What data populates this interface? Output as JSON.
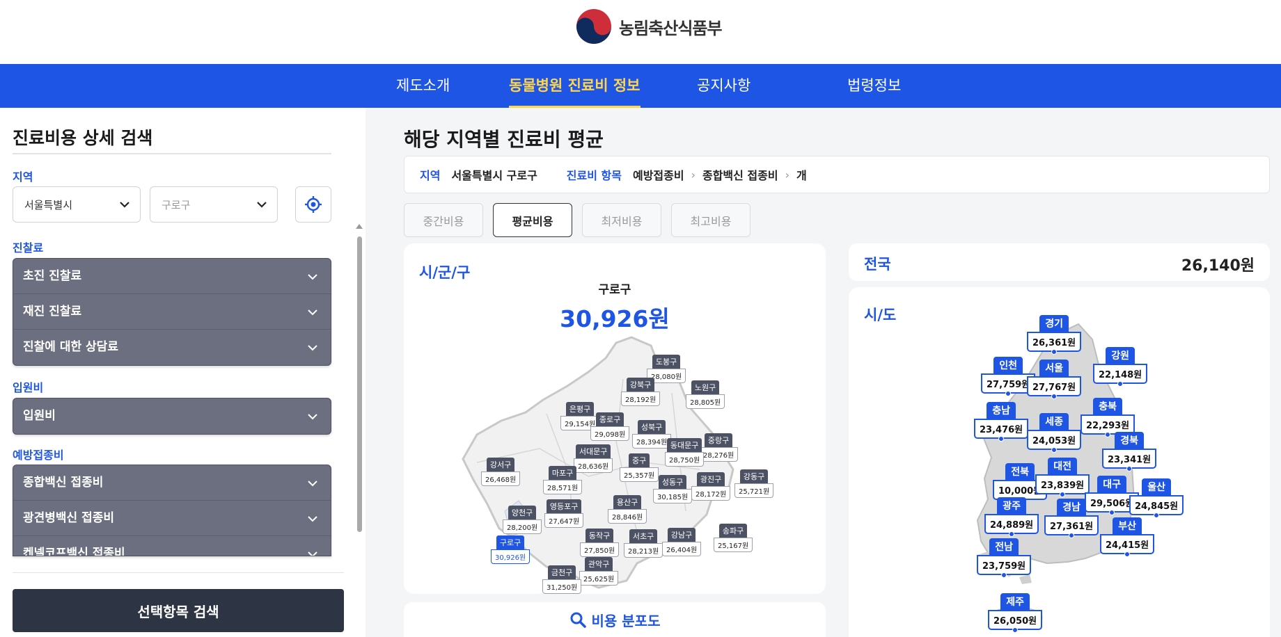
{
  "header": {
    "ministry_name": "농림축산식품부"
  },
  "nav": {
    "items": [
      {
        "label": "제도소개"
      },
      {
        "label": "동물병원 진료비 정보"
      },
      {
        "label": "공지사항"
      },
      {
        "label": "법령정보"
      }
    ],
    "active_index": 1
  },
  "sidebar": {
    "title": "진료비용 상세 검색",
    "region_label": "지역",
    "city_select": "서울특별시",
    "district_select": "구로구",
    "sections": [
      {
        "label": "진찰료",
        "items": [
          "초진 진찰료",
          "재진 진찰료",
          "진찰에 대한 상담료"
        ]
      },
      {
        "label": "입원비",
        "items": [
          "입원비"
        ]
      },
      {
        "label": "예방접종비",
        "items": [
          "종합백신 접종비",
          "광견병백신 접종비",
          "켄넬코프백신 접종비"
        ]
      }
    ],
    "search_button": "선택항목 검색"
  },
  "main": {
    "title": "해당 지역별 진료비 평균",
    "crumbs": {
      "region_key": "지역",
      "region_value": "서울특별시 구로구",
      "item_key": "진료비 항목",
      "item_path": [
        "예방접종비",
        "종합백신 접종비",
        "개"
      ]
    },
    "tabs": [
      "중간비용",
      "평균비용",
      "최저비용",
      "최고비용"
    ],
    "active_tab": 1,
    "district_card": {
      "label": "시/군/구",
      "selected_name": "구로구",
      "selected_amount": "30,926원",
      "districts": [
        {
          "name": "도봉구",
          "value": "28,080원"
        },
        {
          "name": "강북구",
          "value": "28,192원"
        },
        {
          "name": "노원구",
          "value": "28,805원"
        },
        {
          "name": "은평구",
          "value": "29,154원"
        },
        {
          "name": "종로구",
          "value": "29,098원"
        },
        {
          "name": "성북구",
          "value": "28,394원"
        },
        {
          "name": "중랑구",
          "value": "28,276원"
        },
        {
          "name": "동대문구",
          "value": "28,750원"
        },
        {
          "name": "서대문구",
          "value": "28,636원"
        },
        {
          "name": "중구",
          "value": "25,357원"
        },
        {
          "name": "강서구",
          "value": "26,468원"
        },
        {
          "name": "마포구",
          "value": "28,571원"
        },
        {
          "name": "성동구",
          "value": "30,185원"
        },
        {
          "name": "광진구",
          "value": "28,172원"
        },
        {
          "name": "강동구",
          "value": "25,721원"
        },
        {
          "name": "용산구",
          "value": "28,846원"
        },
        {
          "name": "영등포구",
          "value": "27,647원"
        },
        {
          "name": "양천구",
          "value": "28,200원"
        },
        {
          "name": "구로구",
          "value": "30,926원"
        },
        {
          "name": "동작구",
          "value": "27,850원"
        },
        {
          "name": "서초구",
          "value": "28,213원"
        },
        {
          "name": "강남구",
          "value": "26,404원"
        },
        {
          "name": "송파구",
          "value": "25,167원"
        },
        {
          "name": "관악구",
          "value": "25,625원"
        },
        {
          "name": "금천구",
          "value": "31,250원"
        }
      ]
    },
    "nation": {
      "label": "전국",
      "amount": "26,140원"
    },
    "sido_card": {
      "label": "시/도",
      "regions": [
        {
          "name": "경기",
          "value": "26,361원"
        },
        {
          "name": "인천",
          "value": "27,759원"
        },
        {
          "name": "서울",
          "value": "27,767원"
        },
        {
          "name": "강원",
          "value": "22,148원"
        },
        {
          "name": "충남",
          "value": "23,476원"
        },
        {
          "name": "세종",
          "value": "24,053원"
        },
        {
          "name": "충북",
          "value": "22,293원"
        },
        {
          "name": "경북",
          "value": "23,341원"
        },
        {
          "name": "전북",
          "value": "10,000원"
        },
        {
          "name": "대전",
          "value": "23,839원"
        },
        {
          "name": "대구",
          "value": "29,506원"
        },
        {
          "name": "울산",
          "value": "24,845원"
        },
        {
          "name": "광주",
          "value": "24,889원"
        },
        {
          "name": "경남",
          "value": "27,361원"
        },
        {
          "name": "부산",
          "value": "24,415원"
        },
        {
          "name": "전남",
          "value": "23,759원"
        },
        {
          "name": "제주",
          "value": "26,050원"
        }
      ]
    },
    "distribution_button": "비용 분포도"
  },
  "colors": {
    "brand_blue": "#1f55e5",
    "nav_active": "#ffd54a",
    "accordion_bg": "#6b6f80",
    "search_button_bg": "#2d3443"
  }
}
